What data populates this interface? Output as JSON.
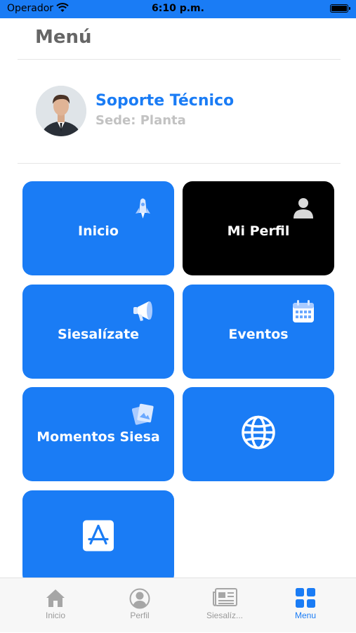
{
  "status_bar": {
    "carrier": "Operador",
    "time": "6:10 p.m."
  },
  "header": {
    "title": "Menú"
  },
  "profile": {
    "name": "Soporte Técnico",
    "site": "Sede: Planta"
  },
  "tiles": [
    {
      "label": "Inicio",
      "icon": "rocket-icon"
    },
    {
      "label": "Mi Perfil",
      "icon": "person-icon"
    },
    {
      "label": "Siesalízate",
      "icon": "megaphone-icon"
    },
    {
      "label": "Eventos",
      "icon": "calendar-icon"
    },
    {
      "label": "Momentos Siesa",
      "icon": "photos-icon"
    },
    {
      "label": "",
      "icon": "globe-icon"
    },
    {
      "label": "",
      "icon": "app-store-icon"
    }
  ],
  "tabbar": [
    {
      "label": "Inicio",
      "icon": "home-icon"
    },
    {
      "label": "Perfil",
      "icon": "profile-icon"
    },
    {
      "label": "Siesalíz...",
      "icon": "newspaper-icon"
    },
    {
      "label": "Menu",
      "icon": "grid-icon",
      "active": true
    }
  ],
  "colors": {
    "primary": "#1a7cf5",
    "dark_tile": "#000000",
    "muted": "#9a9a9a"
  }
}
